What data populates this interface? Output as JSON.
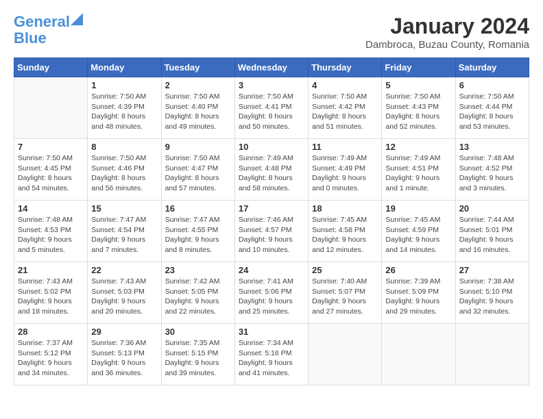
{
  "header": {
    "logo_line1": "General",
    "logo_line2": "Blue",
    "month": "January 2024",
    "location": "Dambroca, Buzau County, Romania"
  },
  "days_of_week": [
    "Sunday",
    "Monday",
    "Tuesday",
    "Wednesday",
    "Thursday",
    "Friday",
    "Saturday"
  ],
  "weeks": [
    [
      {
        "day": "",
        "info": ""
      },
      {
        "day": "1",
        "info": "Sunrise: 7:50 AM\nSunset: 4:39 PM\nDaylight: 8 hours\nand 48 minutes."
      },
      {
        "day": "2",
        "info": "Sunrise: 7:50 AM\nSunset: 4:40 PM\nDaylight: 8 hours\nand 49 minutes."
      },
      {
        "day": "3",
        "info": "Sunrise: 7:50 AM\nSunset: 4:41 PM\nDaylight: 8 hours\nand 50 minutes."
      },
      {
        "day": "4",
        "info": "Sunrise: 7:50 AM\nSunset: 4:42 PM\nDaylight: 8 hours\nand 51 minutes."
      },
      {
        "day": "5",
        "info": "Sunrise: 7:50 AM\nSunset: 4:43 PM\nDaylight: 8 hours\nand 52 minutes."
      },
      {
        "day": "6",
        "info": "Sunrise: 7:50 AM\nSunset: 4:44 PM\nDaylight: 8 hours\nand 53 minutes."
      }
    ],
    [
      {
        "day": "7",
        "info": "Sunrise: 7:50 AM\nSunset: 4:45 PM\nDaylight: 8 hours\nand 54 minutes."
      },
      {
        "day": "8",
        "info": "Sunrise: 7:50 AM\nSunset: 4:46 PM\nDaylight: 8 hours\nand 56 minutes."
      },
      {
        "day": "9",
        "info": "Sunrise: 7:50 AM\nSunset: 4:47 PM\nDaylight: 8 hours\nand 57 minutes."
      },
      {
        "day": "10",
        "info": "Sunrise: 7:49 AM\nSunset: 4:48 PM\nDaylight: 8 hours\nand 58 minutes."
      },
      {
        "day": "11",
        "info": "Sunrise: 7:49 AM\nSunset: 4:49 PM\nDaylight: 9 hours\nand 0 minutes."
      },
      {
        "day": "12",
        "info": "Sunrise: 7:49 AM\nSunset: 4:51 PM\nDaylight: 9 hours\nand 1 minute."
      },
      {
        "day": "13",
        "info": "Sunrise: 7:48 AM\nSunset: 4:52 PM\nDaylight: 9 hours\nand 3 minutes."
      }
    ],
    [
      {
        "day": "14",
        "info": "Sunrise: 7:48 AM\nSunset: 4:53 PM\nDaylight: 9 hours\nand 5 minutes."
      },
      {
        "day": "15",
        "info": "Sunrise: 7:47 AM\nSunset: 4:54 PM\nDaylight: 9 hours\nand 7 minutes."
      },
      {
        "day": "16",
        "info": "Sunrise: 7:47 AM\nSunset: 4:55 PM\nDaylight: 9 hours\nand 8 minutes."
      },
      {
        "day": "17",
        "info": "Sunrise: 7:46 AM\nSunset: 4:57 PM\nDaylight: 9 hours\nand 10 minutes."
      },
      {
        "day": "18",
        "info": "Sunrise: 7:45 AM\nSunset: 4:58 PM\nDaylight: 9 hours\nand 12 minutes."
      },
      {
        "day": "19",
        "info": "Sunrise: 7:45 AM\nSunset: 4:59 PM\nDaylight: 9 hours\nand 14 minutes."
      },
      {
        "day": "20",
        "info": "Sunrise: 7:44 AM\nSunset: 5:01 PM\nDaylight: 9 hours\nand 16 minutes."
      }
    ],
    [
      {
        "day": "21",
        "info": "Sunrise: 7:43 AM\nSunset: 5:02 PM\nDaylight: 9 hours\nand 18 minutes."
      },
      {
        "day": "22",
        "info": "Sunrise: 7:43 AM\nSunset: 5:03 PM\nDaylight: 9 hours\nand 20 minutes."
      },
      {
        "day": "23",
        "info": "Sunrise: 7:42 AM\nSunset: 5:05 PM\nDaylight: 9 hours\nand 22 minutes."
      },
      {
        "day": "24",
        "info": "Sunrise: 7:41 AM\nSunset: 5:06 PM\nDaylight: 9 hours\nand 25 minutes."
      },
      {
        "day": "25",
        "info": "Sunrise: 7:40 AM\nSunset: 5:07 PM\nDaylight: 9 hours\nand 27 minutes."
      },
      {
        "day": "26",
        "info": "Sunrise: 7:39 AM\nSunset: 5:09 PM\nDaylight: 9 hours\nand 29 minutes."
      },
      {
        "day": "27",
        "info": "Sunrise: 7:38 AM\nSunset: 5:10 PM\nDaylight: 9 hours\nand 32 minutes."
      }
    ],
    [
      {
        "day": "28",
        "info": "Sunrise: 7:37 AM\nSunset: 5:12 PM\nDaylight: 9 hours\nand 34 minutes."
      },
      {
        "day": "29",
        "info": "Sunrise: 7:36 AM\nSunset: 5:13 PM\nDaylight: 9 hours\nand 36 minutes."
      },
      {
        "day": "30",
        "info": "Sunrise: 7:35 AM\nSunset: 5:15 PM\nDaylight: 9 hours\nand 39 minutes."
      },
      {
        "day": "31",
        "info": "Sunrise: 7:34 AM\nSunset: 5:16 PM\nDaylight: 9 hours\nand 41 minutes."
      },
      {
        "day": "",
        "info": ""
      },
      {
        "day": "",
        "info": ""
      },
      {
        "day": "",
        "info": ""
      }
    ]
  ]
}
